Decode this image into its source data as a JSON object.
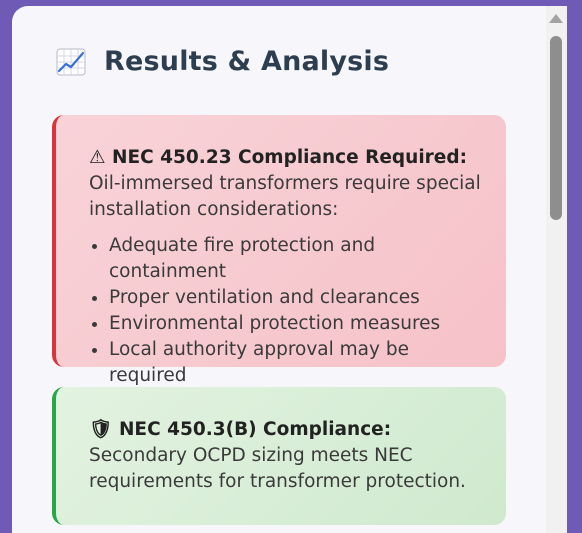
{
  "panel": {
    "title": "Results & Analysis",
    "title_icon": "chart-increasing-icon"
  },
  "warning_card": {
    "icon": "⚠",
    "title": "NEC 450.23 Compliance Required:",
    "text": "Oil-immersed transformers require special installation considerations:",
    "items": [
      "Adequate fire protection and containment",
      "Proper ventilation and clearances",
      "Environmental protection measures",
      "Local authority approval may be required"
    ],
    "accent_color": "#d9343c"
  },
  "success_card": {
    "icon": "🛡",
    "title": "NEC 450.3(B) Compliance:",
    "text": "Secondary OCPD sizing meets NEC requirements for transformer protection.",
    "accent_color": "#29a748"
  },
  "colors": {
    "background": "#6f5bb6",
    "panel": "#f6f6fb",
    "heading": "#2c3e50"
  }
}
